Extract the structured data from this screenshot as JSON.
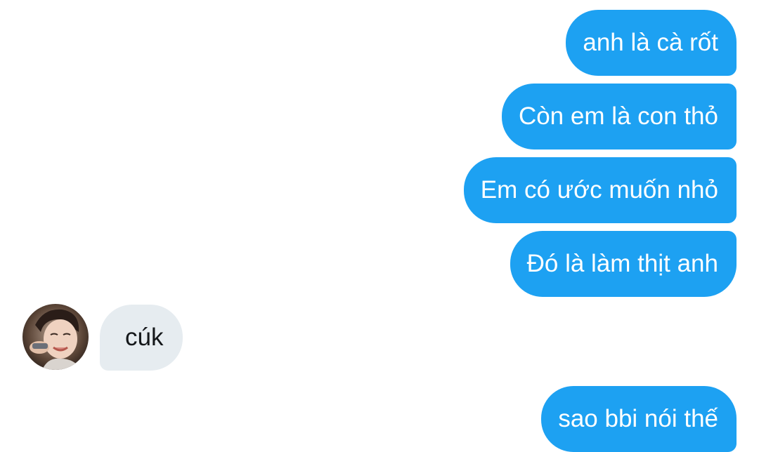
{
  "conversation": {
    "messages": [
      {
        "sender": "me",
        "text": "anh là cà rốt"
      },
      {
        "sender": "me",
        "text": "Còn em là con thỏ"
      },
      {
        "sender": "me",
        "text": "Em có ước muốn nhỏ"
      },
      {
        "sender": "me",
        "text": "Đó là làm thịt anh"
      },
      {
        "sender": "them",
        "text": "cúk"
      },
      {
        "sender": "me",
        "text": "sao bbi nói thế"
      }
    ]
  },
  "colors": {
    "outgoing_bubble": "#1da1f2",
    "outgoing_text": "#ffffff",
    "incoming_bubble": "#e6ecf0",
    "incoming_text": "#14171a",
    "background": "#ffffff"
  },
  "icons": {
    "avatar": "contact-avatar-photo"
  }
}
